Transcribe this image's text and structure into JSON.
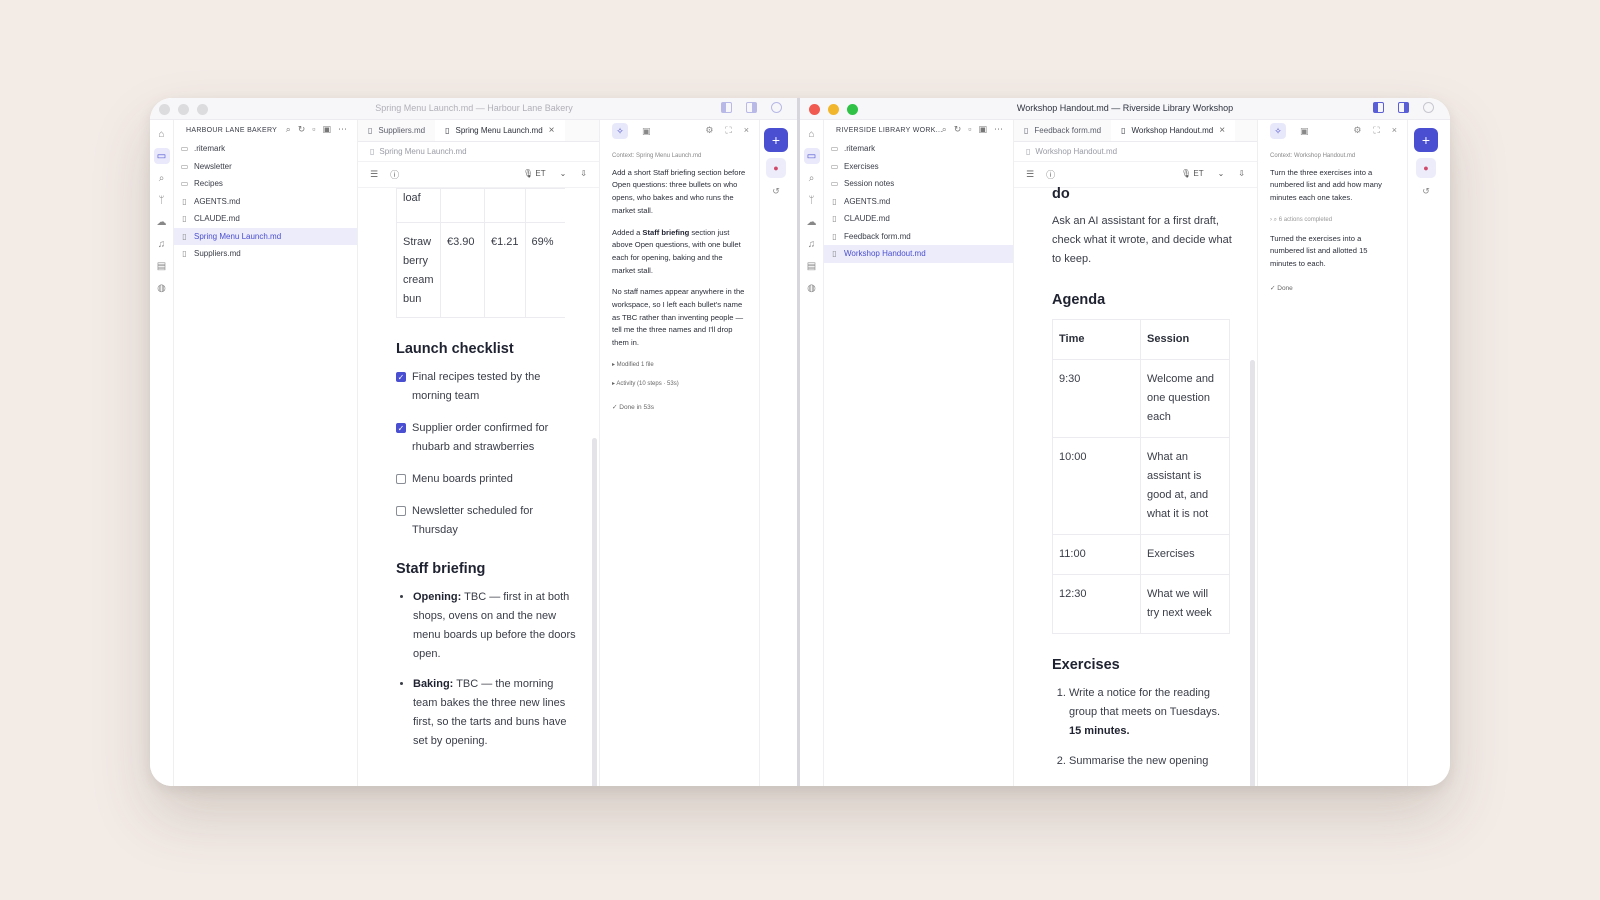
{
  "left": {
    "window_title": "Spring Menu Launch.md — Harbour Lane Bakery",
    "workspace": "HARBOUR LANE BAKERY",
    "files": [
      {
        "name": ".ritemark",
        "type": "folder"
      },
      {
        "name": "Newsletter",
        "type": "folder"
      },
      {
        "name": "Recipes",
        "type": "folder"
      },
      {
        "name": "AGENTS.md",
        "type": "file"
      },
      {
        "name": "CLAUDE.md",
        "type": "file"
      },
      {
        "name": "Spring Menu Launch.md",
        "type": "file",
        "selected": true
      },
      {
        "name": "Suppliers.md",
        "type": "file"
      }
    ],
    "tabs": [
      "Suppliers.md",
      "Spring Menu Launch.md"
    ],
    "breadcrumb": "Spring Menu Launch.md",
    "toolbar_lang": "ET",
    "table_rows": [
      [
        "loaf",
        "",
        "",
        ""
      ],
      [
        "Straw berry cream bun",
        "€3.90",
        "€1.21",
        "69%"
      ]
    ],
    "checklist_heading": "Launch checklist",
    "checklist": [
      {
        "text": "Final recipes tested by the morning team",
        "checked": true
      },
      {
        "text": "Supplier order confirmed for rhubarb and strawberries",
        "checked": true
      },
      {
        "text": "Menu boards printed",
        "checked": false
      },
      {
        "text": "Newsletter scheduled for Thursday",
        "checked": false
      }
    ],
    "briefing_heading": "Staff briefing",
    "briefing": [
      {
        "label": "Opening:",
        "text": "TBC — first in at both shops, ovens on and the new menu boards up before the doors open."
      },
      {
        "label": "Baking:",
        "text": "TBC — the morning team bakes the three new lines first, so the tarts and buns have set by opening."
      }
    ],
    "ai": {
      "context": "Context: Spring Menu Launch.md",
      "prompt": "Add a short Staff briefing section before Open questions: three bullets on who opens, who bakes and who runs the market stall.",
      "reply1_a": "Added a ",
      "reply1_bold": "Staff briefing",
      "reply1_b": " section just above Open questions, with one bullet each for opening, baking and the market stall.",
      "reply2": "No staff names appear anywhere in the workspace, so I left each bullet's name as TBC rather than inventing people — tell me the three names and I'll drop them in.",
      "modified": "▸ Modified 1 file",
      "activity": "▸ Activity (10 steps · 53s)",
      "done": "✓  Done in 53s"
    }
  },
  "right": {
    "window_title": "Workshop Handout.md — Riverside Library Workshop",
    "workspace": "RIVERSIDE LIBRARY WORK...",
    "files": [
      {
        "name": ".ritemark",
        "type": "folder"
      },
      {
        "name": "Exercises",
        "type": "folder"
      },
      {
        "name": "Session notes",
        "type": "folder"
      },
      {
        "name": "AGENTS.md",
        "type": "file"
      },
      {
        "name": "CLAUDE.md",
        "type": "file"
      },
      {
        "name": "Feedback form.md",
        "type": "file"
      },
      {
        "name": "Workshop Handout.md",
        "type": "file",
        "selected": true
      }
    ],
    "tabs": [
      "Feedback form.md",
      "Workshop Handout.md"
    ],
    "breadcrumb": "Workshop Handout.md",
    "toolbar_lang": "ET",
    "top_fragment": "do",
    "intro": "Ask an AI assistant for a first draft, check what it wrote, and decide what to keep.",
    "agenda_heading": "Agenda",
    "agenda_headers": [
      "Time",
      "Session"
    ],
    "agenda": [
      [
        "9:30",
        "Welcome and one question each"
      ],
      [
        "10:00",
        "What an assistant is good at, and what it is not"
      ],
      [
        "11:00",
        "Exercises"
      ],
      [
        "12:30",
        "What we will try next week"
      ]
    ],
    "exercises_heading": "Exercises",
    "ex1_text": "Write a notice for the reading group that meets on Tuesdays. ",
    "ex1_bold": "15 minutes.",
    "ex2_text": "Summarise the new opening",
    "ai": {
      "context": "Context: Workshop Handout.md",
      "prompt": "Turn the three exercises into a numbered list and add how many minutes each one takes.",
      "actions": "›  ⌕ 6 actions completed",
      "reply": "Turned the exercises into a numbered list and allotted 15 minutes to each.",
      "done": "✓  Done"
    }
  }
}
